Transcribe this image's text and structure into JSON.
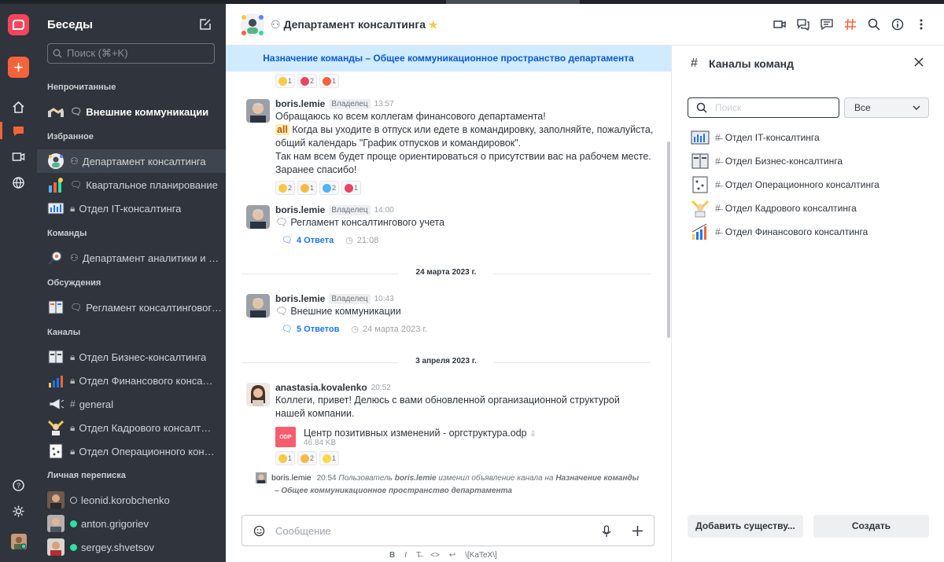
{
  "sidebar": {
    "title": "Беседы",
    "search_placeholder": "Поиск (⌘+K)",
    "sections": {
      "unread": "Непрочитанные",
      "favorites": "Избранное",
      "teams": "Команды",
      "discussions": "Обсуждения",
      "channels": "Каналы",
      "direct": "Личная переписка"
    },
    "items": {
      "unread_1": "Внешние коммуникации",
      "fav_1": "Департамент консалтинга",
      "fav_2": "Квартальное планирование",
      "fav_3": "Отдел IT-консалтинга",
      "team_1": "Департамент аналитики и исследований",
      "disc_1": "Регламент консалтингового учета",
      "ch_1": "Отдел Бизнес-консалтинга",
      "ch_2": "Отдел Финансового консалтинга",
      "ch_3": "general",
      "ch_4": "Отдел Кадрового консалтинга",
      "ch_5": "Отдел Операционного консалтинга",
      "dm_1": "leonid.korobchenko",
      "dm_2": "anton.grigoriev",
      "dm_3": "sergey.shvetsov"
    }
  },
  "header": {
    "title": "Департамент консалтинга",
    "announcement": "Назначение команды – Общее коммуникационное пространство департамента"
  },
  "messages": {
    "top_reactions": [
      "1",
      "2",
      "1"
    ],
    "m1": {
      "user": "boris.lemie",
      "role": "Владелец",
      "time": "13:57",
      "line1": "Обращаюсь ко всем коллегам финансового департамента!",
      "mention": "all",
      "line2": " Когда вы уходите в отпуск или едете в командировку, заполняйте, пожалуйста,",
      "line3": "общий календарь \"График отпусков и командировок\".",
      "line4": "Так нам всем будет проще ориентироваться о присутствии вас на рабочем месте.",
      "line5": "Заранее спасибо!",
      "reactions": [
        "2",
        "1",
        "2",
        "1"
      ]
    },
    "m2": {
      "user": "boris.lemie",
      "role": "Владелец",
      "time": "14:00",
      "text": "Регламент консалтингового учета",
      "replies": "4 Ответа",
      "reply_time": "21:08"
    },
    "date1": "24 марта 2023 г.",
    "m3": {
      "user": "boris.lemie",
      "role": "Владелец",
      "time": "10:43",
      "text": "Внешние коммуникации",
      "replies": "5 Ответов",
      "reply_time": "24 марта 2023 г."
    },
    "date2": "3 апреля 2023 г.",
    "m4": {
      "user": "anastasia.kovalenko",
      "time": "20:52",
      "line1": "Коллеги, привет! Делюсь с вами обновленной организационной структурой",
      "line2": "нашей компании.",
      "file_type": "ODP",
      "file_name": "Центр позитивных изменений - оргструктура.odp",
      "file_size": "46.84 KB",
      "reactions": [
        "1",
        "2",
        "1"
      ]
    },
    "system": {
      "user": "boris.lemie",
      "time": "20:54",
      "prefix": "Пользователь",
      "actor": "boris.lemie",
      "action": "изменил объявление канала на",
      "value_part1": "Назначение команды",
      "value_part2": "– Общее коммуникационное пространство департамента"
    }
  },
  "composer": {
    "placeholder": "Сообщение",
    "formatting": [
      "B",
      "I",
      "T̶",
      "<>",
      "↩",
      "\\[KaTeX\\]"
    ]
  },
  "right_panel": {
    "title": "Каналы команд",
    "search_placeholder": "Поиск",
    "filter_value": "Все",
    "channels": [
      "Отдел IT-консалтинга",
      "Отдел Бизнес-консалтинга",
      "Отдел Операционного консалтинга",
      "Отдел Кадрового консалтинга",
      "Отдел Финансового консалтинга"
    ],
    "add_existing": "Добавить существу...",
    "create": "Создать"
  },
  "colors": {
    "brand": "#f5455c",
    "accent": "#f5633a",
    "link": "#1d74f5",
    "sidebar_bg": "#2f343d",
    "announce_bg": "#d1ebfe",
    "online": "#2de0a5"
  }
}
